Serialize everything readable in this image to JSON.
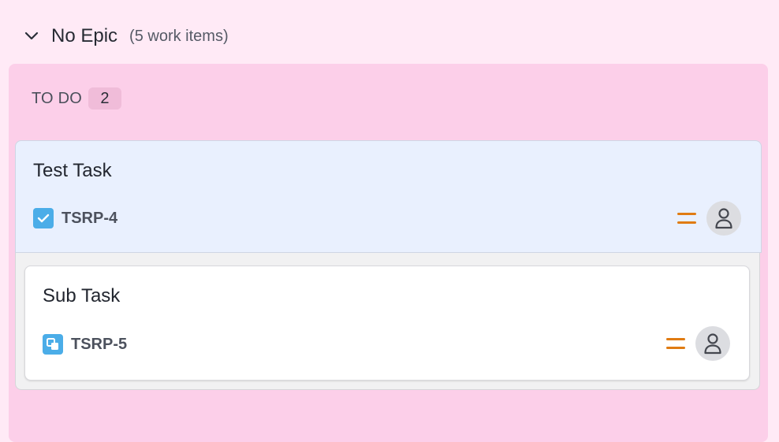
{
  "epic": {
    "title": "No Epic",
    "count_label": "(5 work items)",
    "chevron_icon": "chevron-down-icon"
  },
  "column": {
    "title": "TO DO",
    "count": "2",
    "background": "#fccfe9"
  },
  "cards": [
    {
      "title": "Test Task",
      "key": "TSRP-4",
      "type_icon": "checkbox-task-icon",
      "priority_icon": "priority-medium-icon",
      "avatar_icon": "unassigned-user-icon"
    },
    {
      "title": "Sub Task",
      "key": "TSRP-5",
      "type_icon": "subtask-icon",
      "priority_icon": "priority-medium-icon",
      "avatar_icon": "unassigned-user-icon"
    }
  ],
  "colors": {
    "page_bg": "#ffeaf6",
    "parent_card_bg": "#e9f0fe",
    "type_icon_blue": "#4bade8",
    "priority_orange": "#e07b12"
  }
}
